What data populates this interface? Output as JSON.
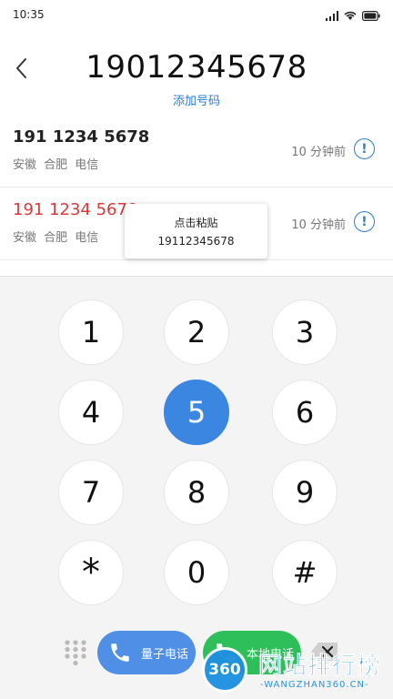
{
  "status_bar": {
    "time": "10:35",
    "icons": [
      "signal-icon",
      "wifi-icon",
      "battery-icon"
    ]
  },
  "header": {
    "back_icon": "chevron-left-icon",
    "number": "19012345678",
    "add_number_label": "添加号码"
  },
  "call_log": [
    {
      "number": "191 1234 5678",
      "location": "安徽  合肥  电信",
      "time": "10 分钟前",
      "missed": false
    },
    {
      "number": "191 1234 5678",
      "location": "安徽  合肥  电信",
      "time": "10 分钟前",
      "missed": true
    }
  ],
  "paste_popup": {
    "title": "点击粘贴",
    "number": "19112345678"
  },
  "keypad": {
    "keys": [
      "1",
      "2",
      "3",
      "4",
      "5",
      "6",
      "7",
      "8",
      "9",
      "*",
      "0",
      "#"
    ],
    "active_key": "5"
  },
  "actions": {
    "quantum_call_label": "量子电话",
    "local_call_label": "本地电话"
  },
  "watermark": {
    "logo_text": "360",
    "title": "网站排行榜",
    "subtitle": "-WANGZHAN360.CN-"
  },
  "colors": {
    "accent": "#2b7bd8",
    "missed": "#d83a3a",
    "key_active": "#3a86e0",
    "quantum_button": "#4f8fe6",
    "local_button": "#2fbf5a"
  }
}
